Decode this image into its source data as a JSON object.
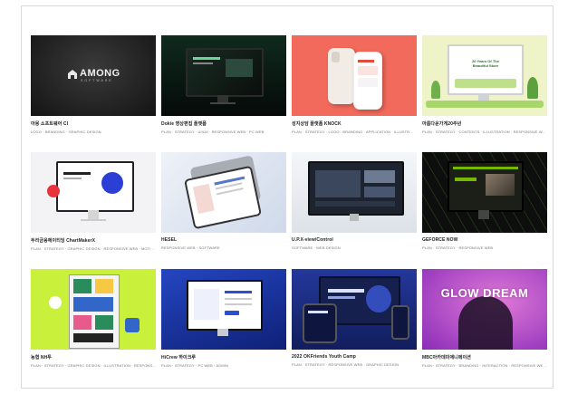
{
  "projects": [
    {
      "title": "아몽 소프트웨어 CI",
      "tags": "LOGO · BRANDING · GRAPHIC DESIGN",
      "thumb_text": "AMONG",
      "thumb_sub": "SOFTWARE"
    },
    {
      "title": "Dokie 영상편집 플랫폼",
      "tags": "PLAN · STRATEGY · UI/UX · RESPONSIVE WEB · PC WEB",
      "thumb_text": "",
      "thumb_sub": ""
    },
    {
      "title": "성지상담 플랫폼 KNOCK",
      "tags": "PLAN · STRATEGY · LOGO · BRANDING · APPLICATION · ILLUSTR…",
      "thumb_text": "",
      "thumb_sub": ""
    },
    {
      "title": "아름다운가게20주년",
      "tags": "PLAN · STRATEGY · CONTENTS · ILLUSTRATION · RESPONSIVE W…",
      "thumb_text": "20 Years Of The Beautiful Store",
      "thumb_sub": ""
    },
    {
      "title": "두리금융에이티딩 ChartMakerX",
      "tags": "PLAN · STRATEGY · GRAPHIC DESIGN · RESPONSIVE WEB · MOTI…",
      "thumb_text": "",
      "thumb_sub": ""
    },
    {
      "title": "HESEL",
      "tags": "RESPONSIVE WEB · SOFTWARE",
      "thumb_text": "",
      "thumb_sub": ""
    },
    {
      "title": "U.P.X-view/Control",
      "tags": "SOFTWARE · WEB DESIGN",
      "thumb_text": "",
      "thumb_sub": ""
    },
    {
      "title": "GEFORCE NOW",
      "tags": "PLAN · STRATEGY · RESPONSIVE WEB",
      "thumb_text": "",
      "thumb_sub": ""
    },
    {
      "title": "농협 NH투",
      "tags": "PLAN · STRATEGY · GRAPHIC DESIGN · ILLUSTRATION · RESPONS…",
      "thumb_text": "",
      "thumb_sub": ""
    },
    {
      "title": "HiCrew 하이크루",
      "tags": "PLAN · STRATEGY · PC WEB · ADMIN",
      "thumb_text": "",
      "thumb_sub": ""
    },
    {
      "title": "2022 OKFriends Youth Camp",
      "tags": "PLAN · STRATEGY · RESPONSIVE WEB · GRAPHIC DESIGN",
      "thumb_text": "",
      "thumb_sub": ""
    },
    {
      "title": "MBC아카데미애니메이션",
      "tags": "PLAN · STRATEGY · BRANDING · INTERACTION · RESPONSIVE WE…",
      "thumb_text": "GLOW DREAM",
      "thumb_sub": ""
    }
  ],
  "colors": {
    "among_bg": "#1c1c1c",
    "dokie_bg": "#0d1a14",
    "knock_bg": "#f26a5b",
    "store_bg": "#eef3c8",
    "chart_bg": "#f3f3f5",
    "hesel_bg": "#dfe6f2",
    "upx_bg": "#e9edf2",
    "geforce_bg": "#0e0e0e",
    "nh_bg": "#c9f03a",
    "hicrew_bg": "#1b3aa8",
    "okfriends_bg": "#1c2f8a",
    "mbc_bg": "#b43fcf"
  }
}
